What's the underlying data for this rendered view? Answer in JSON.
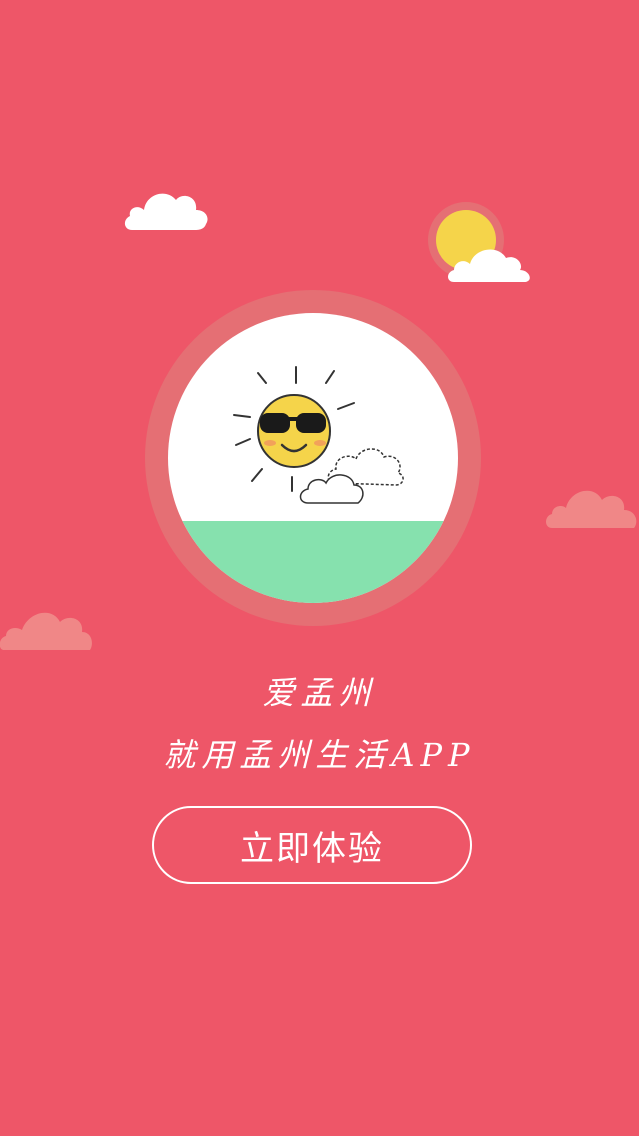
{
  "colors": {
    "background": "#ee5668",
    "ring": "#e56f74",
    "disc": "#ffffff",
    "ground": "#86e1ae",
    "sun": "#f5d44a",
    "cloud_pink": "#f08787",
    "cloud_white": "#ffffff",
    "text": "#ffffff"
  },
  "icons": {
    "top_left": "cloud-icon",
    "top_right": "sun-behind-cloud-icon",
    "hero": "sunglasses-sun-icon",
    "side_clouds": "cloud-icon"
  },
  "splash": {
    "title": "爱孟州",
    "subtitle": "就用孟州生活APP",
    "cta_label": "立即体验"
  }
}
